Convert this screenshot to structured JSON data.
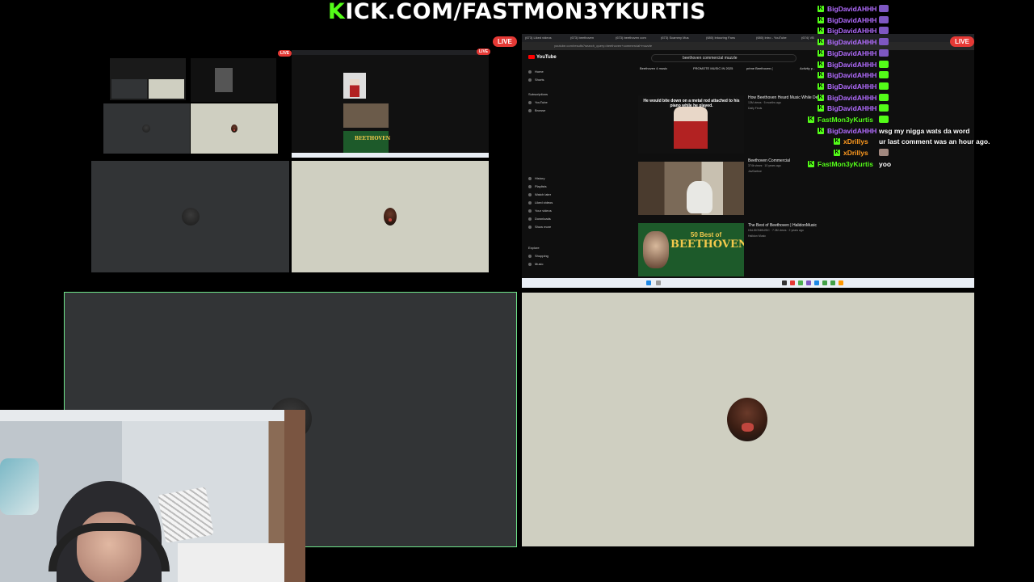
{
  "banner": {
    "prefix": "K",
    "text": "ICK.COM/FASTMON3YKURTIS"
  },
  "live_label": "LIVE",
  "colors": {
    "kick_green": "#53fc18",
    "live_red": "#e53935",
    "active_border": "#6ee58a"
  },
  "youtube": {
    "logo": "YouTube",
    "search_query": "beethoven commercial muzzle",
    "tabs": [
      "(673) Liked videos",
      "(673) beethoven",
      "(673) beethoven com",
      "(673) Scammy Mus",
      "(680) Intouring Fans",
      "(680) Intro - YouTube",
      "(674) VB"
    ],
    "address": "youtube.com/results?search_query=beethoven+commercial+muzzle",
    "chips": [
      "Beethoven 4 music",
      "PROMOTE MUSIC IN 2025",
      "prime Beethoven (",
      "Activity p..."
    ],
    "sidebar": [
      "Home",
      "Shorts",
      "Subscriptions",
      "YouTube",
      "Browse",
      "History",
      "Playlists",
      "Watch later",
      "Liked videos",
      "Your videos",
      "Downloads",
      "Show more",
      "Explore",
      "Shopping",
      "Music"
    ],
    "results": [
      {
        "title": "How Beethoven Heard Music While De...",
        "meta": "13M views · 5 months ago",
        "channel": "Daily Finds",
        "thumb_caption": "He would bite down on a metal rod attached to his piano while he played."
      },
      {
        "title": "Beethoven Commercial",
        "meta": "374k views · 10 years ago",
        "channel": "JavDarboe",
        "thumb_caption": ""
      },
      {
        "title": "The Best of Beethoven | HalidonMusic",
        "meta": "HALIDONMUSIC · 7.3M views · 2 years ago",
        "channel": "Halidon Music",
        "thumb_caption": ""
      }
    ],
    "thumb_small": "50 Best of",
    "thumb_big": "BEETHOVEN"
  },
  "chat": [
    {
      "user": "BigDavidAHHH",
      "user_color": "#b26cff",
      "message": "",
      "badge_color": "#7e57c2"
    },
    {
      "user": "BigDavidAHHH",
      "user_color": "#b26cff",
      "message": "",
      "badge_color": "#7e57c2"
    },
    {
      "user": "BigDavidAHHH",
      "user_color": "#b26cff",
      "message": "",
      "badge_color": "#7e57c2"
    },
    {
      "user": "BigDavidAHHH",
      "user_color": "#b26cff",
      "message": "",
      "badge_color": "#7e57c2"
    },
    {
      "user": "BigDavidAHHH",
      "user_color": "#b26cff",
      "message": "",
      "badge_color": "#7e57c2"
    },
    {
      "user": "BigDavidAHHH",
      "user_color": "#b26cff",
      "message": "",
      "badge_color": "#53fc18"
    },
    {
      "user": "BigDavidAHHH",
      "user_color": "#b26cff",
      "message": "",
      "badge_color": "#53fc18"
    },
    {
      "user": "BigDavidAHHH",
      "user_color": "#b26cff",
      "message": "",
      "badge_color": "#53fc18"
    },
    {
      "user": "BigDavidAHHH",
      "user_color": "#b26cff",
      "message": "",
      "badge_color": "#53fc18"
    },
    {
      "user": "BigDavidAHHH",
      "user_color": "#b26cff",
      "message": "",
      "badge_color": "#53fc18"
    },
    {
      "user": "FastMon3yKurtis",
      "user_color": "#53fc18",
      "message": "",
      "badge_color": "#53fc18"
    },
    {
      "user": "BigDavidAHHH",
      "user_color": "#b26cff",
      "message": "wsg my nigga wats da word",
      "badge_color": ""
    },
    {
      "user": "xDrillys",
      "user_color": "#ff9a1f",
      "message": "ur last comment was an hour ago.",
      "badge_color": ""
    },
    {
      "user": "xDrillys",
      "user_color": "#ff9a1f",
      "message": "",
      "badge_color": "#a1887f"
    },
    {
      "user": "FastMon3yKurtis",
      "user_color": "#53fc18",
      "message": "yoo",
      "badge_color": ""
    }
  ]
}
